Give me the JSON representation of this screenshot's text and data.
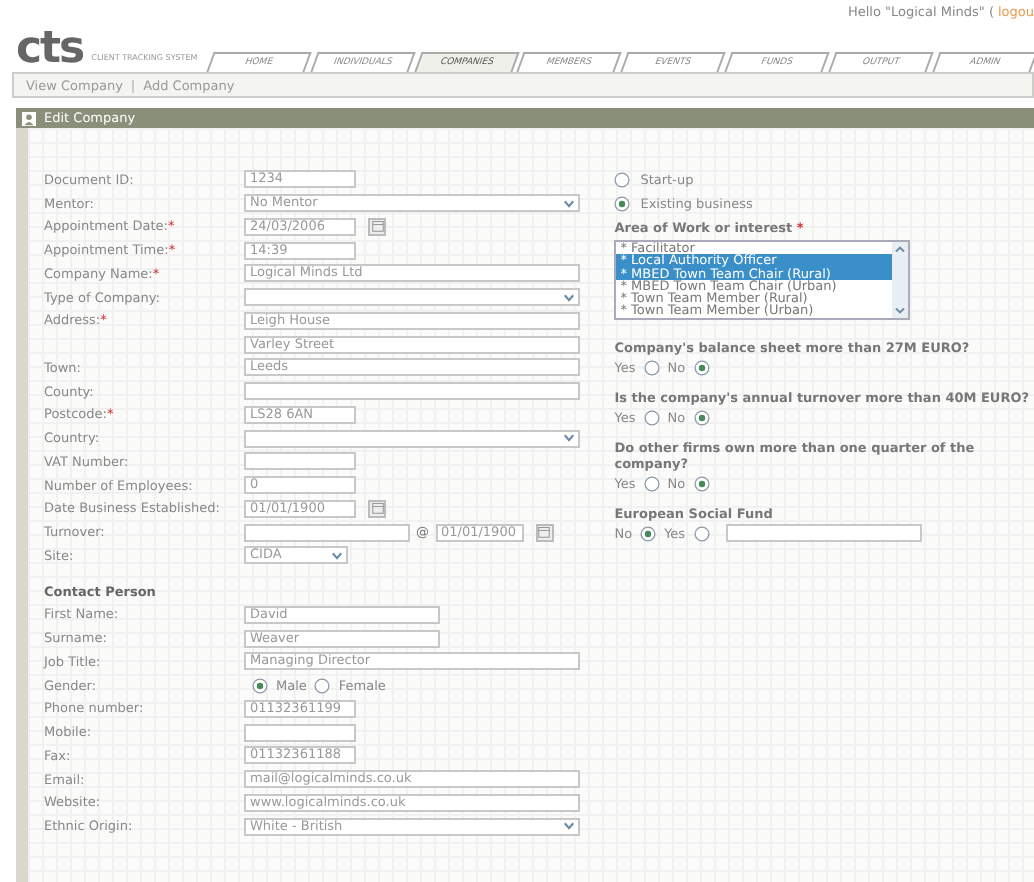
{
  "header": {
    "greeting": "Hello \"Logical Minds\" (",
    "logout_link": "logou"
  },
  "logo": {
    "mark": "cts",
    "tagline": "CLIENT TRACKING SYSTEM"
  },
  "tabs": [
    {
      "label": "HOME",
      "selected": false
    },
    {
      "label": "INDIVIDUALS",
      "selected": false
    },
    {
      "label": "COMPANIES",
      "selected": true
    },
    {
      "label": "MEMBERS",
      "selected": false
    },
    {
      "label": "EVENTS",
      "selected": false
    },
    {
      "label": "FUNDS",
      "selected": false
    },
    {
      "label": "OUTPUT",
      "selected": false
    },
    {
      "label": "ADMIN",
      "selected": false
    }
  ],
  "subnav": {
    "links": [
      "View Company",
      "Add Company"
    ],
    "separator": "|"
  },
  "panel": {
    "title": "Edit Company"
  },
  "fields": [
    {
      "kind": "short",
      "label": "Document ID:",
      "value": "1234"
    },
    {
      "kind": "select",
      "label": "Mentor:",
      "value": "No Mentor"
    },
    {
      "kind": "date",
      "label": "Appointment Date:",
      "mark": "*",
      "value": "24/03/2006"
    },
    {
      "kind": "short",
      "label": "Appointment Time:",
      "mark": "*",
      "value": "14:39"
    },
    {
      "kind": "text",
      "label": "Company Name:",
      "mark": "*",
      "value": "Logical Minds Ltd"
    },
    {
      "kind": "select",
      "label": "Type of Company:"
    },
    {
      "kind": "text",
      "label": "Address:",
      "mark": "*",
      "value": "Leigh House"
    },
    {
      "kind": "text",
      "value": "Varley Street"
    },
    {
      "kind": "text",
      "label": "Town:",
      "value": "Leeds"
    },
    {
      "kind": "text",
      "label": "County:"
    },
    {
      "kind": "short",
      "label": "Postcode:",
      "mark": "*",
      "value": "LS28 6AN"
    },
    {
      "kind": "select",
      "label": "Country:"
    },
    {
      "kind": "short",
      "label": "VAT Number:"
    },
    {
      "kind": "short",
      "label": "Number of Employees:",
      "value": "0"
    },
    {
      "kind": "date",
      "label": "Date Business Established:",
      "value": "01/01/1900"
    },
    {
      "kind": "turnover",
      "label": "Turnover:",
      "at": "@",
      "date": "01/01/1900"
    },
    {
      "kind": "select_short",
      "label": "Site:",
      "value": "CIDA"
    },
    {
      "kind": "heading",
      "label": "Contact Person"
    },
    {
      "kind": "medium",
      "label": "First Name:",
      "value": "David"
    },
    {
      "kind": "medium",
      "label": "Surname:",
      "value": "Weaver"
    },
    {
      "kind": "text",
      "label": "Job Title:",
      "value": "Managing Director"
    },
    {
      "kind": "radio",
      "label": "Gender:",
      "options": [
        {
          "label": "Male",
          "selected": true
        },
        {
          "label": "Female",
          "selected": false
        }
      ]
    },
    {
      "kind": "short",
      "label": "Phone number:",
      "value": "01132361199"
    },
    {
      "kind": "short",
      "label": "Mobile:"
    },
    {
      "kind": "short",
      "label": "Fax:",
      "value": "01132361188"
    },
    {
      "kind": "text",
      "label": "Email:",
      "value": "mail@logicalminds.co.uk"
    },
    {
      "kind": "text",
      "label": "Website:",
      "value": "www.logicalminds.co.uk"
    },
    {
      "kind": "select",
      "label": "Ethnic Origin:",
      "value": "White - British"
    }
  ],
  "business_type": [
    {
      "label": "Start-up",
      "selected": false
    },
    {
      "label": "Existing business",
      "selected": true
    }
  ],
  "area_of_work": {
    "label": "Area of Work or interest",
    "mark": "*",
    "options": [
      {
        "label": "* Facilitator",
        "selected": false
      },
      {
        "label": "* Local Authority Officer",
        "selected": true
      },
      {
        "label": "* MBED Town Team Chair (Rural)",
        "selected": true
      },
      {
        "label": "* MBED Town Team Chair (Urban)",
        "selected": false
      },
      {
        "label": "* Town Team Member (Rural)",
        "selected": false
      },
      {
        "label": "* Town Team Member (Urban)",
        "selected": false
      }
    ]
  },
  "questions": [
    {
      "kind": "yes_no",
      "question": "Company's balance sheet more than 27M EURO?",
      "options": [
        {
          "label": "Yes",
          "selected": false
        },
        {
          "label": "No",
          "selected": true
        }
      ]
    },
    {
      "kind": "yes_no",
      "question": "Is the company's annual turnover more than 40M EURO?",
      "options": [
        {
          "label": "Yes",
          "selected": false
        },
        {
          "label": "No",
          "selected": true
        }
      ]
    },
    {
      "kind": "yes_no",
      "question": "Do other firms own more than one quarter of the company?",
      "options": [
        {
          "label": "Yes",
          "selected": false
        },
        {
          "label": "No",
          "selected": true
        }
      ]
    },
    {
      "kind": "with_field",
      "question": "European Social Fund",
      "options": [
        {
          "label": "No",
          "selected": true
        },
        {
          "label": "Yes",
          "selected": false
        }
      ]
    }
  ]
}
